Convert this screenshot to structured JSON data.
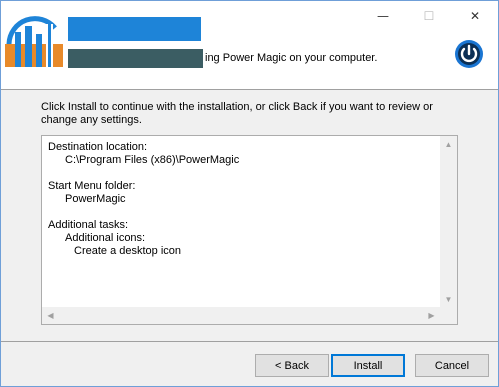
{
  "window": {
    "controls": {
      "minimize": "—",
      "maximize": "☐",
      "close": "✕"
    }
  },
  "header": {
    "subtitle": "ing Power Magic on your computer.",
    "colors": {
      "redact_top": "#1e84d8",
      "redact_bottom": "#3b5d63",
      "power_icon": "#1a75d2"
    }
  },
  "instructions": "Click Install to continue with the installation, or click Back if you want to review or change any settings.",
  "summary": {
    "destination_label": "Destination location:",
    "destination_value": "C:\\Program Files (x86)\\PowerMagic",
    "start_menu_label": "Start Menu folder:",
    "start_menu_value": "PowerMagic",
    "tasks_label": "Additional tasks:",
    "icons_label": "Additional icons:",
    "desktop_icon": "Create a desktop icon"
  },
  "scrollbar": {
    "up": "▲",
    "down": "▼",
    "left": "◀",
    "right": "▶"
  },
  "buttons": {
    "back": "< Back",
    "install": "Install",
    "cancel": "Cancel"
  }
}
